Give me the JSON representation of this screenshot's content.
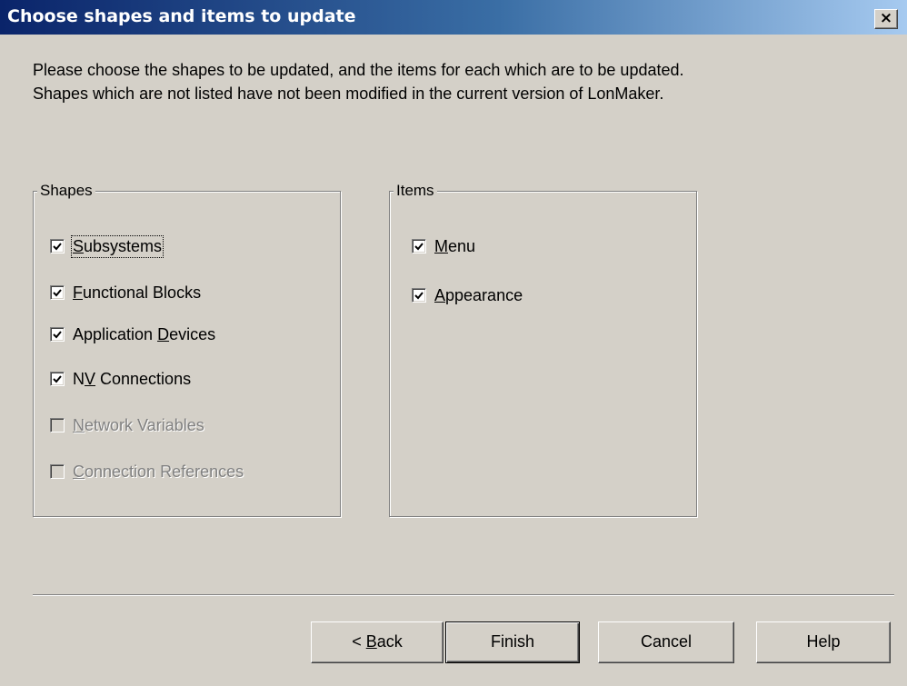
{
  "window": {
    "title": "Choose shapes and items to update",
    "close_glyph": "×"
  },
  "intro_text": "Please choose the shapes to be updated, and the items for each which are to be updated. Shapes which are not listed have not been modified in the current version of LonMaker.",
  "shapes_group": {
    "legend": "Shapes",
    "items": [
      {
        "pre": "",
        "mn": "S",
        "post": "ubsystems",
        "checked": true,
        "enabled": true
      },
      {
        "pre": "",
        "mn": "F",
        "post": "unctional Blocks",
        "checked": true,
        "enabled": true
      },
      {
        "pre": "Application ",
        "mn": "D",
        "post": "evices",
        "checked": true,
        "enabled": true
      },
      {
        "pre": "N",
        "mn": "V",
        "post": " Connections",
        "checked": true,
        "enabled": true
      },
      {
        "pre": "",
        "mn": "N",
        "post": "etwork Variables",
        "checked": false,
        "enabled": false
      },
      {
        "pre": "",
        "mn": "C",
        "post": "onnection References",
        "checked": false,
        "enabled": false
      }
    ]
  },
  "items_group": {
    "legend": "Items",
    "items": [
      {
        "pre": "",
        "mn": "M",
        "post": "enu",
        "checked": true,
        "enabled": true
      },
      {
        "pre": "",
        "mn": "A",
        "post": "ppearance",
        "checked": true,
        "enabled": true
      }
    ]
  },
  "buttons": {
    "back": {
      "pre": "< ",
      "mn": "B",
      "post": "ack"
    },
    "finish": "Finish",
    "cancel": "Cancel",
    "help": "Help"
  },
  "icons": {
    "checkmark": "checkmark-icon",
    "close": "close-icon"
  },
  "colors": {
    "title_start": "#0a246a",
    "title_end": "#a6caf0",
    "face": "#d4d0c8",
    "disabled_text": "#808080"
  }
}
